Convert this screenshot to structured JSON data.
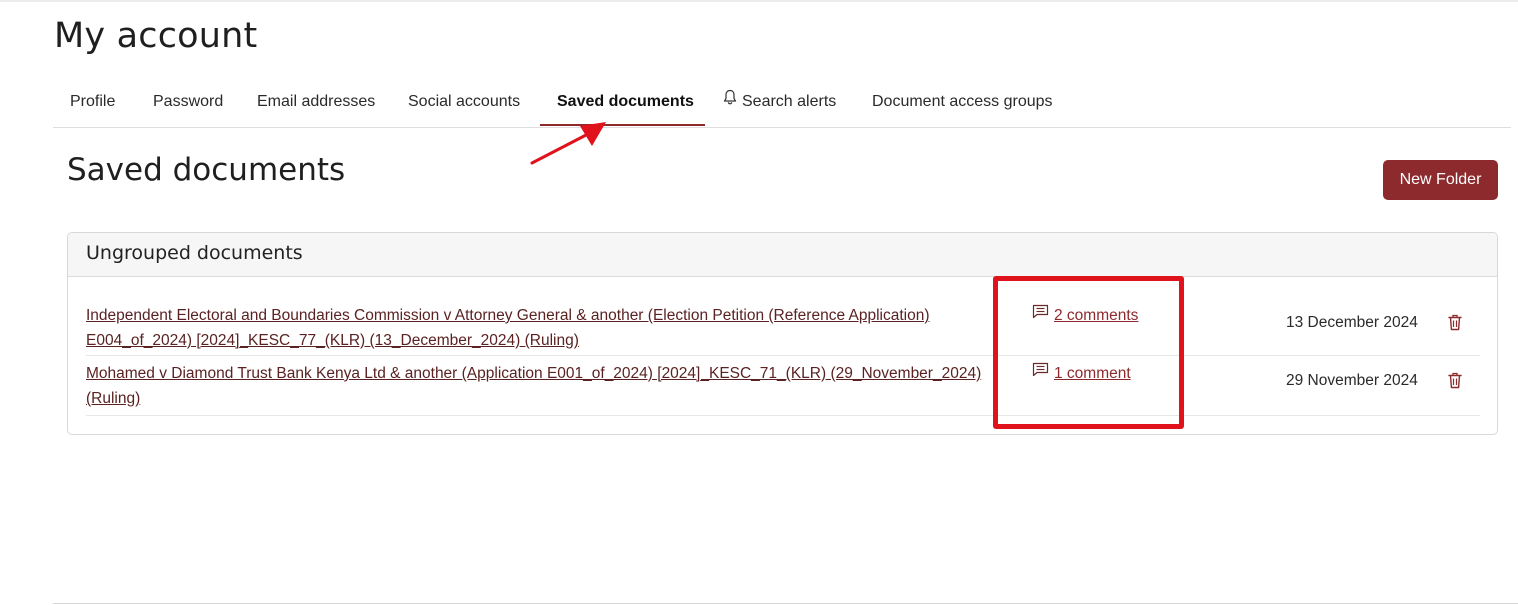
{
  "page": {
    "title": "My account"
  },
  "tabs": [
    {
      "label": "Profile",
      "active": false
    },
    {
      "label": "Password",
      "active": false
    },
    {
      "label": "Email addresses",
      "active": false
    },
    {
      "label": "Social accounts",
      "active": false
    },
    {
      "label": "Saved documents",
      "active": true
    },
    {
      "label": "Search alerts",
      "active": false,
      "icon": "bell-icon"
    },
    {
      "label": "Document access groups",
      "active": false
    }
  ],
  "section": {
    "title": "Saved documents",
    "new_folder_label": "New Folder"
  },
  "group": {
    "title": "Ungrouped documents",
    "documents": [
      {
        "title": "Independent Electoral and Boundaries Commission v Attorney General & another (Election Petition (Reference Application) E004_of_2024) [2024]_KESC_77_(KLR) (13_December_2024) (Ruling)",
        "comments_label": "2 comments",
        "date": "13 December 2024"
      },
      {
        "title": "Mohamed v Diamond Trust Bank Kenya Ltd & another (Application E001_of_2024) [2024]_KESC_71_(KLR) (29_November_2024) (Ruling)",
        "comments_label": "1 comment",
        "date": "29 November 2024"
      }
    ]
  },
  "icons": {
    "comments": "comment-icon",
    "delete": "trash-icon",
    "alerts": "bell-icon"
  },
  "colors": {
    "accent": "#8c2a2d",
    "annotation": "#e0121b",
    "link": "#5a2222"
  }
}
